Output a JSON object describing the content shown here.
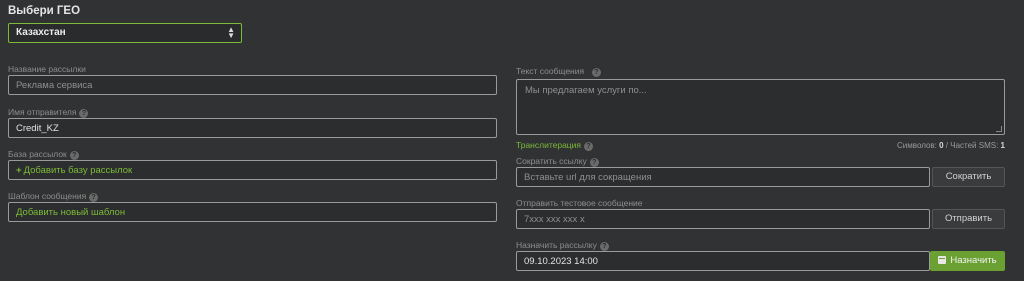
{
  "geo": {
    "title": "Выбери ГЕО",
    "selected": "Казахстан"
  },
  "left": {
    "campaign_name": {
      "label": "Название рассылки",
      "placeholder": "Реклама сервиса"
    },
    "sender_name": {
      "label": "Имя отправителя",
      "value": "Credit_KZ"
    },
    "database": {
      "label": "База рассылок",
      "add_text": "Добавить базу рассылок"
    },
    "template": {
      "label": "Шаблон сообщения",
      "add_text": "Добавить новый шаблон"
    }
  },
  "right": {
    "message": {
      "label": "Текст сообщения",
      "placeholder": "Мы предлагаем услуги по..."
    },
    "transliteration": "Транслитерация",
    "counter": {
      "symbols_label": "Символов:",
      "symbols_value": "0",
      "parts_label": "Частей SMS:",
      "parts_value": "1"
    },
    "shorten": {
      "label": "Сократить ссылку",
      "placeholder": "Вставьте url для сокращения",
      "button": "Сократить"
    },
    "test": {
      "label": "Отправить тестовое сообщение",
      "placeholder": "7xxx xxx xxx x",
      "button": "Отправить"
    },
    "schedule": {
      "label": "Назначить рассылку",
      "value": "09.10.2023 14:00",
      "button": "Назначить"
    }
  },
  "colors": {
    "accent": "#7cbb3a",
    "background": "#313233"
  },
  "icons": [
    "chevron-updown-icon",
    "help-icon",
    "plus-icon",
    "calendar-icon",
    "resize-handle-icon"
  ]
}
